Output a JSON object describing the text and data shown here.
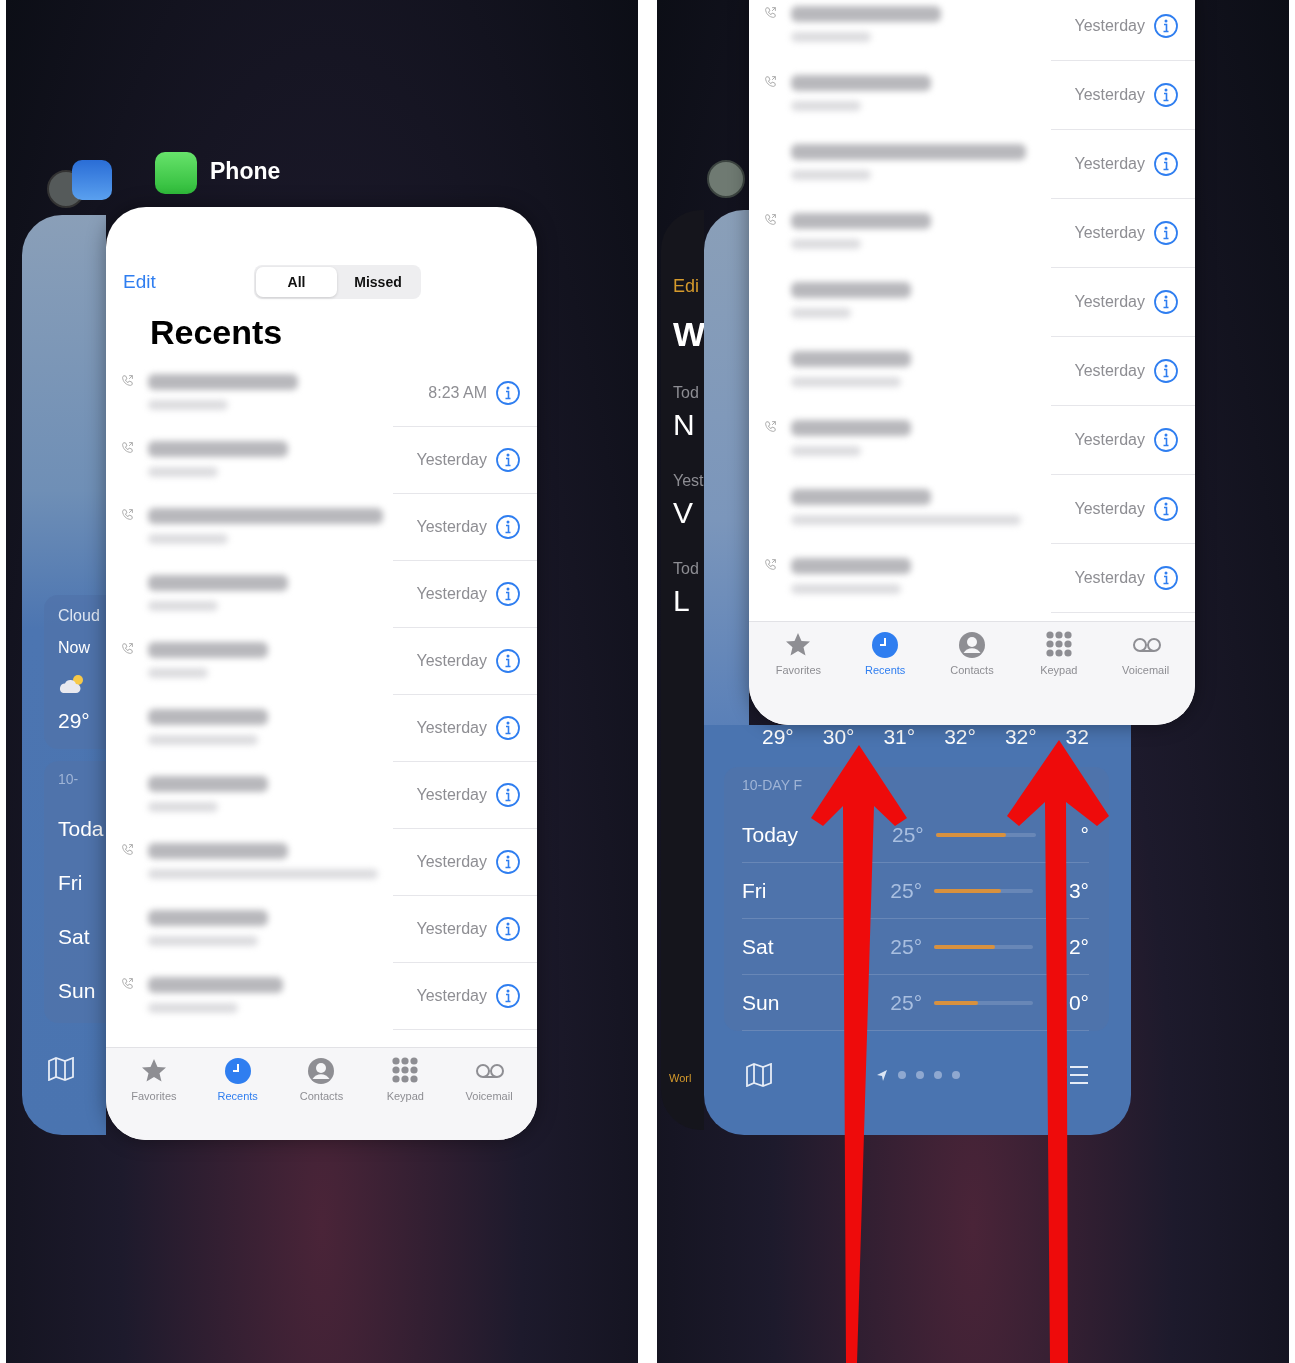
{
  "left": {
    "app_label": "Phone",
    "weather": {
      "hourly_label": "Cloud",
      "now_label": "Now",
      "now_temp": "29°",
      "forecast_label": "10-",
      "days": [
        "Toda",
        "Fri",
        "Sat",
        "Sun"
      ]
    },
    "phone": {
      "edit": "Edit",
      "segments": [
        {
          "label": "All",
          "selected": true
        },
        {
          "label": "Missed",
          "selected": false
        }
      ],
      "title": "Recents",
      "rows": [
        {
          "time": "8:23 AM",
          "call_icon": true
        },
        {
          "time": "Yesterday",
          "call_icon": true
        },
        {
          "time": "Yesterday",
          "call_icon": true
        },
        {
          "time": "Yesterday",
          "call_icon": false
        },
        {
          "time": "Yesterday",
          "call_icon": true
        },
        {
          "time": "Yesterday",
          "call_icon": false
        },
        {
          "time": "Yesterday",
          "call_icon": false
        },
        {
          "time": "Yesterday",
          "call_icon": true
        },
        {
          "time": "Yesterday",
          "call_icon": false
        },
        {
          "time": "Yesterday",
          "call_icon": true
        }
      ],
      "tabs": [
        {
          "label": "Favorites",
          "selected": false
        },
        {
          "label": "Recents",
          "selected": true
        },
        {
          "label": "Contacts",
          "selected": false
        },
        {
          "label": "Keypad",
          "selected": false
        },
        {
          "label": "Voicemail",
          "selected": false
        }
      ]
    }
  },
  "right": {
    "clock_texts": [
      {
        "kind": "link",
        "text": "Edi"
      },
      {
        "kind": "title",
        "text": "W"
      },
      {
        "kind": "small",
        "text": "Tod"
      },
      {
        "kind": "big",
        "text": "N"
      },
      {
        "kind": "small",
        "text": "Yest"
      },
      {
        "kind": "big",
        "text": "V"
      },
      {
        "kind": "small",
        "text": "Tod"
      },
      {
        "kind": "big",
        "text": "L"
      }
    ],
    "clock_tab": "Worl",
    "weather": {
      "hourly": [
        "29°",
        "30°",
        "31°",
        "32°",
        "32°",
        "32"
      ],
      "forecast_label": "10-DAY F",
      "days": [
        {
          "day": "Today",
          "low": "25°",
          "high": "°",
          "level": 0.7
        },
        {
          "day": "Fri",
          "low": "25°",
          "high": "3°",
          "level": 0.68
        },
        {
          "day": "Sat",
          "low": "25°",
          "high": "2°",
          "level": 0.62
        },
        {
          "day": "Sun",
          "low": "25°",
          "high": "0°",
          "level": 0.44
        }
      ]
    },
    "phone": {
      "rows": [
        {
          "time": "Yesterday",
          "call_icon": true
        },
        {
          "time": "Yesterday",
          "call_icon": true
        },
        {
          "time": "Yesterday",
          "call_icon": false
        },
        {
          "time": "Yesterday",
          "call_icon": true
        },
        {
          "time": "Yesterday",
          "call_icon": false
        },
        {
          "time": "Yesterday",
          "call_icon": false
        },
        {
          "time": "Yesterday",
          "call_icon": true
        },
        {
          "time": "Yesterday",
          "call_icon": false
        },
        {
          "time": "Yesterday",
          "call_icon": true
        }
      ],
      "tabs": [
        {
          "label": "Favorites",
          "selected": false
        },
        {
          "label": "Recents",
          "selected": true
        },
        {
          "label": "Contacts",
          "selected": false
        },
        {
          "label": "Keypad",
          "selected": false
        },
        {
          "label": "Voicemail",
          "selected": false
        }
      ]
    }
  }
}
